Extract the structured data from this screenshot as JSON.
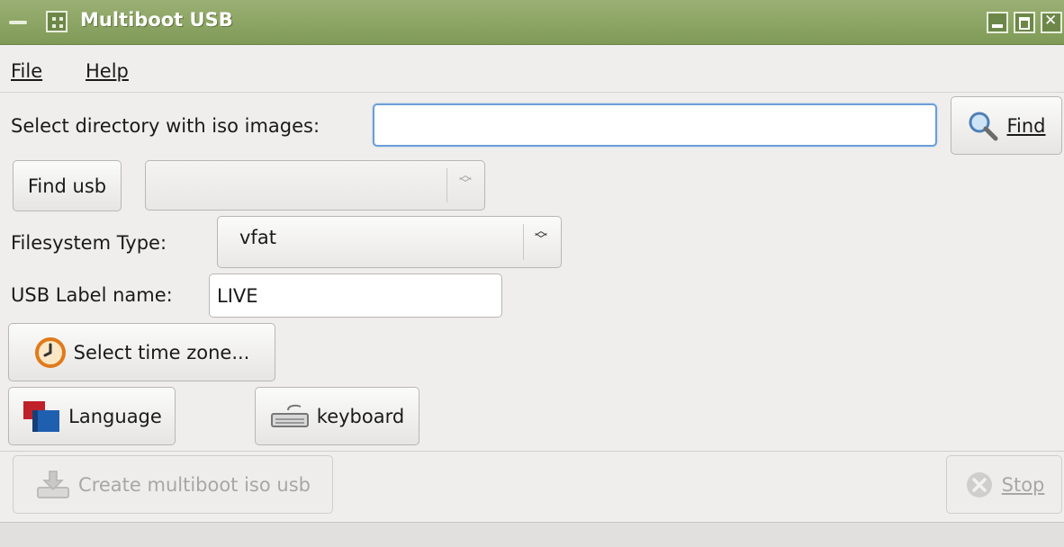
{
  "window": {
    "title": "Multiboot USB"
  },
  "menu": {
    "file": "File",
    "help": "Help"
  },
  "iso_dir": {
    "label": "Select directory with iso images:",
    "value": "",
    "find_button": "Find"
  },
  "usb": {
    "find_button": "Find usb",
    "device_value": ""
  },
  "filesystem": {
    "label": "Filesystem Type:",
    "value": "vfat"
  },
  "usb_label": {
    "label": "USB Label name:",
    "value": "LIVE"
  },
  "timezone": {
    "button": "Select time zone..."
  },
  "language": {
    "button": "Language"
  },
  "keyboard": {
    "button": "keyboard"
  },
  "actions": {
    "create_button": "Create multiboot iso usb",
    "stop_button": "Stop"
  },
  "colors": {
    "titlebar": "#8ba562",
    "focus_border": "#6d9ed6",
    "background": "#efeeed"
  }
}
